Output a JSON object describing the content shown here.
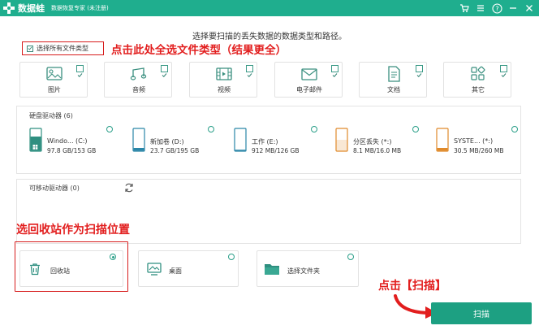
{
  "titlebar": {
    "app_name": "数据蛙",
    "subtitle": "数据恢复专家 (未注册)",
    "icons": [
      "cart-icon",
      "menu-icon",
      "help-icon",
      "minimize-icon",
      "close-icon"
    ]
  },
  "instruction": "选择要扫描的丢失数据的数据类型和路径。",
  "select_all": {
    "label": "选择所有文件类型",
    "checked": true
  },
  "annotations": {
    "select_all_note": "点击此处全选文件类型（结果更全）",
    "recycle_note": "选回收站作为扫描位置",
    "scan_note": "点击【扫描】"
  },
  "categories": [
    {
      "label": "图片",
      "icon": "image-icon",
      "checked": true
    },
    {
      "label": "音频",
      "icon": "audio-icon",
      "checked": true
    },
    {
      "label": "视频",
      "icon": "video-icon",
      "checked": true
    },
    {
      "label": "电子邮件",
      "icon": "email-icon",
      "checked": true
    },
    {
      "label": "文档",
      "icon": "document-icon",
      "checked": true
    },
    {
      "label": "其它",
      "icon": "other-icon",
      "checked": true
    }
  ],
  "hard_drives": {
    "title": "硬盘驱动器 (6)",
    "drives": [
      {
        "name": "Windo... (C:)",
        "size": "97.8 GB/153 GB",
        "icon": "windows-drive-icon",
        "fill": 0.64
      },
      {
        "name": "新加卷 (D:)",
        "size": "23.7 GB/195 GB",
        "icon": "drive-icon",
        "fill": 0.12
      },
      {
        "name": "工作 (E:)",
        "size": "912 MB/126 GB",
        "icon": "drive-icon",
        "fill": 0.01
      },
      {
        "name": "分区丢失 (*:)",
        "size": "8.1 MB/16.0 MB",
        "icon": "lost-partition-icon",
        "fill": 0.5
      },
      {
        "name": "SYSTE... (*:)",
        "size": "30.5 MB/260 MB",
        "icon": "system-drive-icon",
        "fill": 0.12
      }
    ]
  },
  "removable": {
    "title": "可移动驱动器 (0)"
  },
  "locations": [
    {
      "name": "回收站",
      "icon": "recycle-bin-icon",
      "selected": true
    },
    {
      "name": "桌面",
      "icon": "desktop-icon",
      "selected": false
    },
    {
      "name": "选择文件夹",
      "icon": "folder-icon",
      "selected": false
    }
  ],
  "scan_button": "扫描",
  "colors": {
    "brand": "#1fae8e",
    "button": "#1da082",
    "annotation": "#e21e1e"
  }
}
